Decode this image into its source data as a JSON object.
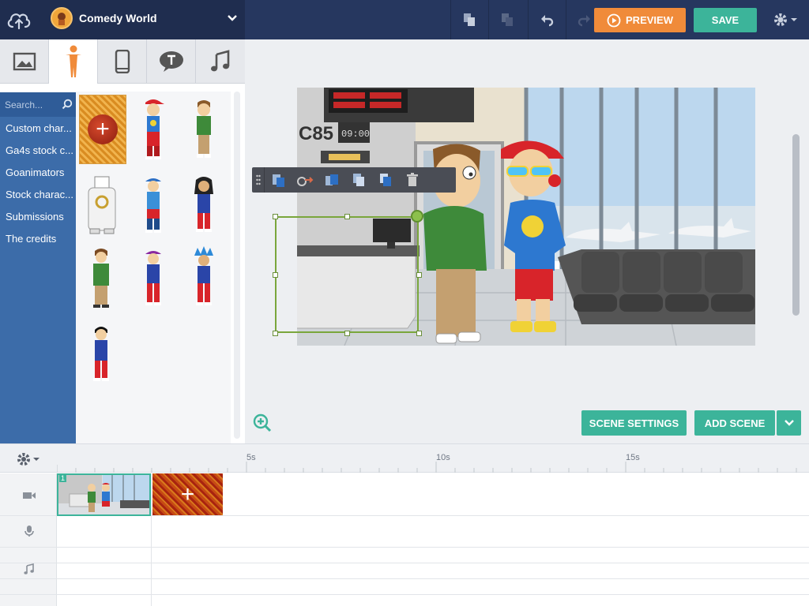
{
  "header": {
    "theme_title": "Comedy World",
    "preview_label": "PREVIEW",
    "save_label": "SAVE"
  },
  "asset_tabs": [
    {
      "name": "backgrounds",
      "icon": "image-icon"
    },
    {
      "name": "characters",
      "icon": "person-icon",
      "active": true
    },
    {
      "name": "props",
      "icon": "phone-icon"
    },
    {
      "name": "text",
      "icon": "speech-bubble-icon"
    },
    {
      "name": "music",
      "icon": "music-note-icon"
    }
  ],
  "sidebar": {
    "search_placeholder": "Search...",
    "categories": [
      "Custom char...",
      "Ga4s stock c...",
      "Goanimators",
      "Stock charac...",
      "Submissions",
      "The credits"
    ]
  },
  "stage": {
    "scene_settings_label": "SCENE SETTINGS",
    "add_scene_label": "ADD SCENE",
    "departure_board_number": "C85",
    "board_time": "09:00"
  },
  "timeline": {
    "ticks": [
      "5s",
      "10s",
      "15s"
    ],
    "scene_number": "1"
  },
  "colors": {
    "topbar": "#26375f",
    "accent_orange": "#f08b3a",
    "accent_green": "#3cb49a",
    "sidebar_blue": "#3c6ca9"
  }
}
